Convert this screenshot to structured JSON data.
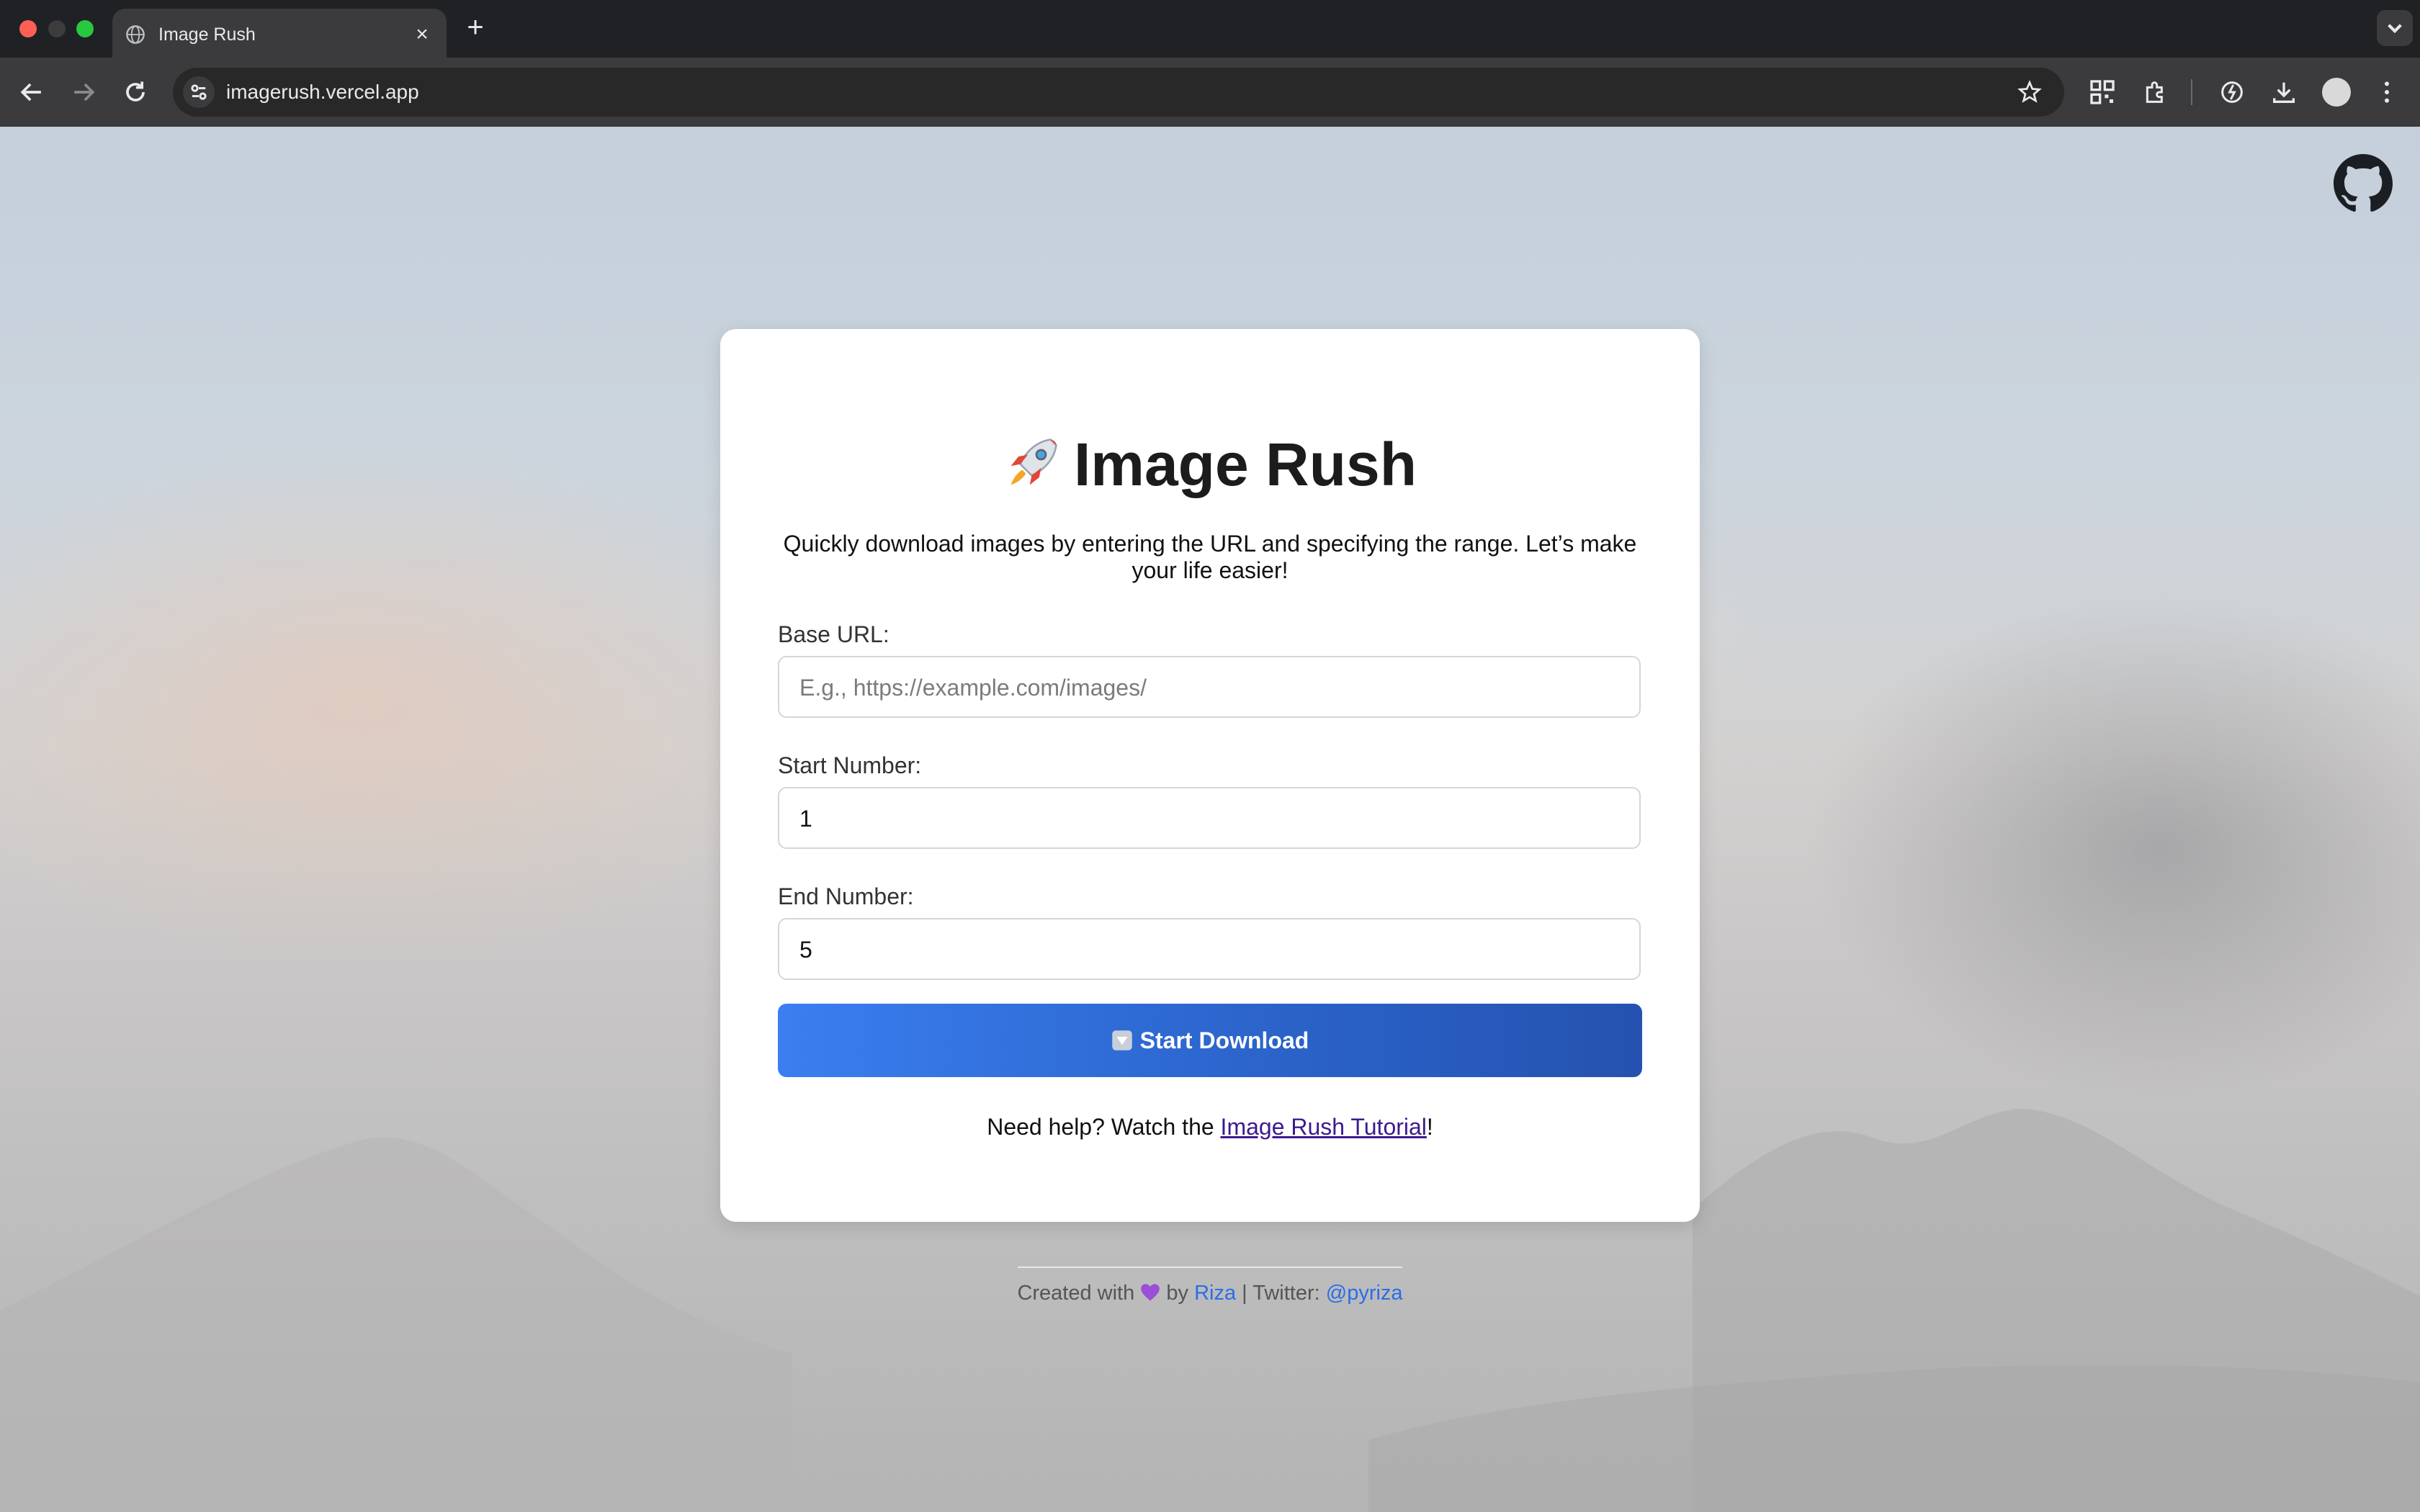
{
  "browser": {
    "tab_title": "Image Rush",
    "new_tab_label": "+",
    "close_tab_label": "×",
    "url": "imagerush.vercel.app"
  },
  "app": {
    "title": "Image Rush",
    "title_icon": "rocket-icon",
    "description": "Quickly download images by entering the URL and specifying the range. Let’s make your life easier!",
    "base_url_label": "Base URL:",
    "base_url_placeholder": "E.g., https://example.com/images/",
    "base_url_value": "",
    "start_label": "Start Number:",
    "start_value": "1",
    "end_label": "End Number:",
    "end_value": "5",
    "button_label": "Start Download",
    "button_icon": "down-arrow-icon",
    "help_prefix": "Need help? Watch the ",
    "help_link": "Image Rush Tutorial",
    "help_suffix": "!"
  },
  "footer": {
    "created": "Created with",
    "by": "by",
    "author": "Riza",
    "twitter_prefix": "| Twitter:",
    "twitter_handle": "@pyriza"
  },
  "colors": {
    "button_start": "#3a7ef0",
    "button_end": "#2552b0",
    "link": "#2a6de8",
    "heart": "#9b4fd8"
  }
}
